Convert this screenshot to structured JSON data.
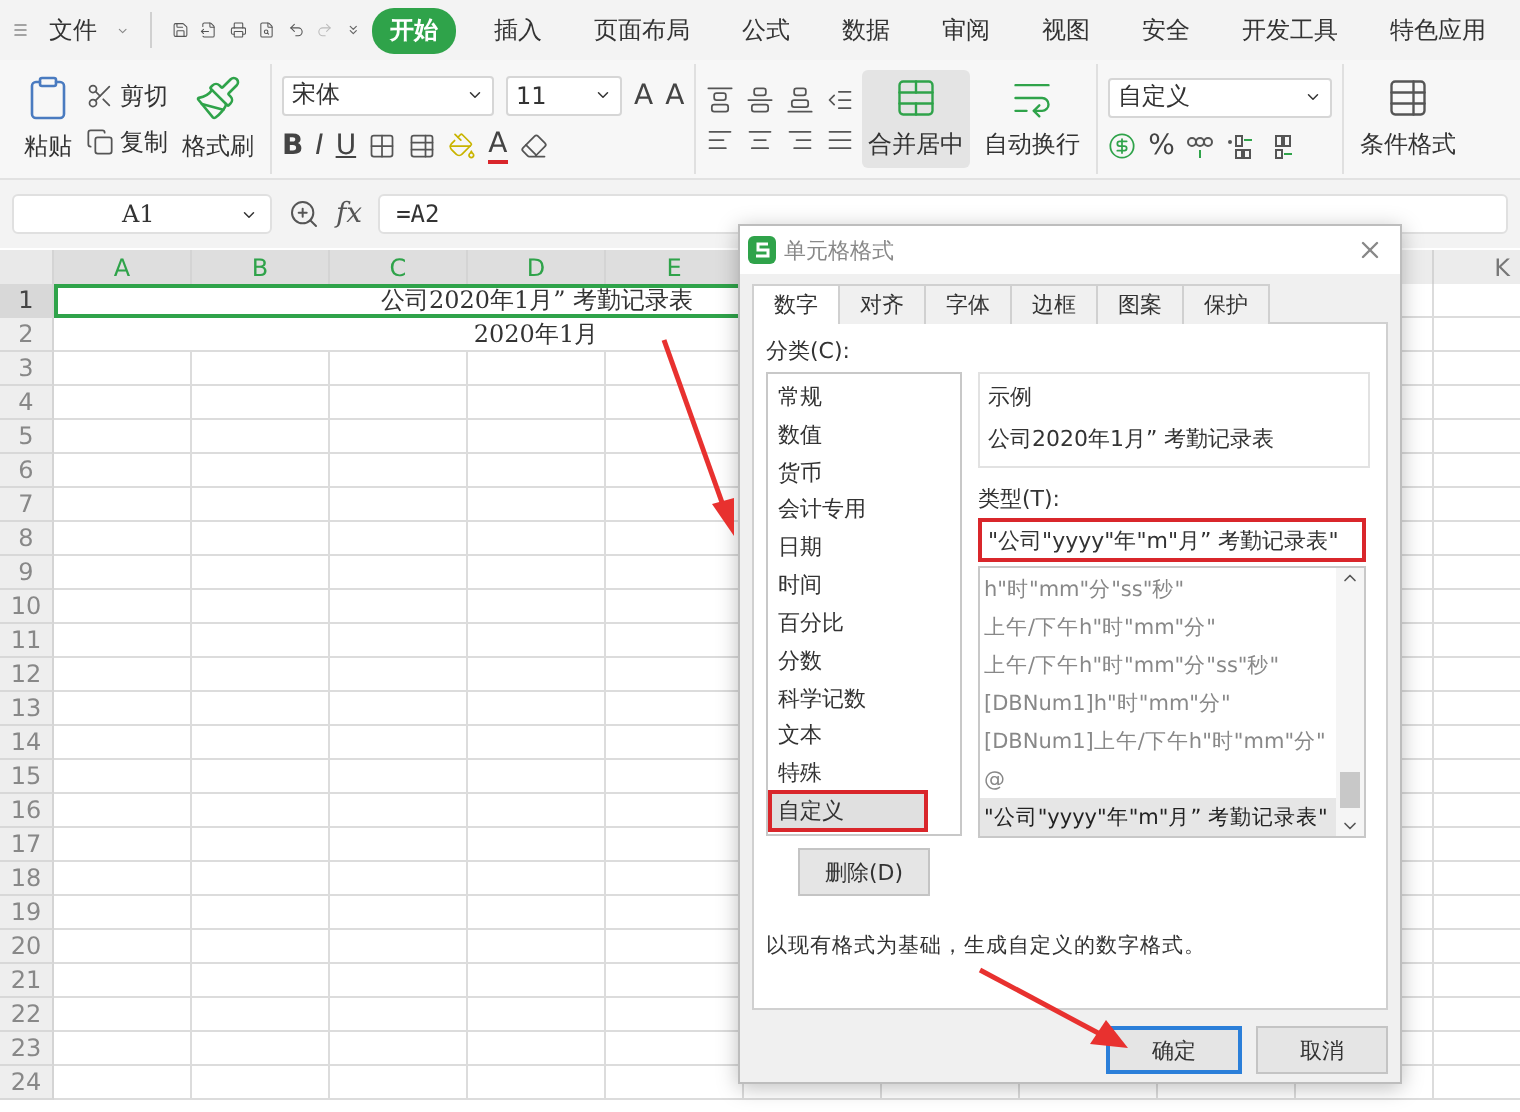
{
  "menu_bar": {
    "file_menu": "文件",
    "tabs": [
      {
        "label": "开始",
        "selected": true
      },
      {
        "label": "插入",
        "selected": false
      },
      {
        "label": "页面布局",
        "selected": false
      },
      {
        "label": "公式",
        "selected": false
      },
      {
        "label": "数据",
        "selected": false
      },
      {
        "label": "审阅",
        "selected": false
      },
      {
        "label": "视图",
        "selected": false
      },
      {
        "label": "安全",
        "selected": false
      },
      {
        "label": "开发工具",
        "selected": false
      },
      {
        "label": "特色应用",
        "selected": false
      }
    ]
  },
  "ribbon": {
    "paste": "粘贴",
    "cut": "剪切",
    "copy": "复制",
    "format_painter": "格式刷",
    "font_name": "宋体",
    "font_size": "11",
    "grow_font": "A",
    "shrink_font": "A",
    "bold": "B",
    "italic": "I",
    "underline": "U",
    "font_color": "A",
    "merge_center": "合并居中",
    "wrap_text": "自动换行",
    "number_format": "自定义",
    "percent": "%",
    "conditional_format": "条件格式"
  },
  "formula_bar": {
    "name_box": "A1",
    "fx": "fx",
    "formula": "=A2"
  },
  "sheet": {
    "columns": [
      {
        "label": "A",
        "selected": true
      },
      {
        "label": "B",
        "selected": true
      },
      {
        "label": "C",
        "selected": true
      },
      {
        "label": "D",
        "selected": true
      },
      {
        "label": "E",
        "selected": true
      }
    ],
    "far_column": {
      "label": "K",
      "selected": false
    },
    "rows": [
      {
        "label": "1",
        "selected": true,
        "merged_text": "公司2020年1月” 考勤记录表"
      },
      {
        "label": "2",
        "selected": false,
        "merged_text": "2020年1月"
      },
      {
        "label": "3",
        "selected": false
      },
      {
        "label": "4",
        "selected": false
      },
      {
        "label": "5",
        "selected": false
      },
      {
        "label": "6",
        "selected": false
      },
      {
        "label": "7",
        "selected": false
      },
      {
        "label": "8",
        "selected": false
      },
      {
        "label": "9",
        "selected": false
      },
      {
        "label": "10",
        "selected": false
      },
      {
        "label": "11",
        "selected": false
      },
      {
        "label": "12",
        "selected": false
      },
      {
        "label": "13",
        "selected": false
      },
      {
        "label": "14",
        "selected": false
      },
      {
        "label": "15",
        "selected": false
      },
      {
        "label": "16",
        "selected": false
      },
      {
        "label": "17",
        "selected": false
      },
      {
        "label": "18",
        "selected": false
      },
      {
        "label": "19",
        "selected": false
      },
      {
        "label": "20",
        "selected": false
      },
      {
        "label": "21",
        "selected": false
      },
      {
        "label": "22",
        "selected": false
      },
      {
        "label": "23",
        "selected": false
      },
      {
        "label": "24",
        "selected": false
      }
    ]
  },
  "dialog": {
    "title": "单元格格式",
    "tabs": [
      {
        "label": "数字",
        "selected": true
      },
      {
        "label": "对齐",
        "selected": false
      },
      {
        "label": "字体",
        "selected": false
      },
      {
        "label": "边框",
        "selected": false
      },
      {
        "label": "图案",
        "selected": false
      },
      {
        "label": "保护",
        "selected": false
      }
    ],
    "category_label": "分类(C):",
    "categories": [
      {
        "label": "常规",
        "selected": false,
        "annotated": false
      },
      {
        "label": "数值",
        "selected": false,
        "annotated": false
      },
      {
        "label": "货币",
        "selected": false,
        "annotated": false
      },
      {
        "label": "会计专用",
        "selected": false,
        "annotated": false
      },
      {
        "label": "日期",
        "selected": false,
        "annotated": false
      },
      {
        "label": "时间",
        "selected": false,
        "annotated": false
      },
      {
        "label": "百分比",
        "selected": false,
        "annotated": false
      },
      {
        "label": "分数",
        "selected": false,
        "annotated": false
      },
      {
        "label": "科学记数",
        "selected": false,
        "annotated": false
      },
      {
        "label": "文本",
        "selected": false,
        "annotated": false
      },
      {
        "label": "特殊",
        "selected": false,
        "annotated": false
      },
      {
        "label": "自定义",
        "selected": true,
        "annotated": true
      }
    ],
    "sample_label": "示例",
    "sample": "公司2020年1月” 考勤记录表",
    "type_label": "类型(T):",
    "type_value": "\"公司\"yyyy\"年\"m\"月” 考勤记录表\"",
    "type_annotated": true,
    "type_list": [
      {
        "label": "h\"时\"mm\"分\"ss\"秒\"",
        "selected": false
      },
      {
        "label": "上午/下午h\"时\"mm\"分\"",
        "selected": false
      },
      {
        "label": "上午/下午h\"时\"mm\"分\"ss\"秒\"",
        "selected": false
      },
      {
        "label": "[DBNum1]h\"时\"mm\"分\"",
        "selected": false
      },
      {
        "label": "[DBNum1]上午/下午h\"时\"mm\"分\"",
        "selected": false
      },
      {
        "label": "@",
        "selected": false
      },
      {
        "label": "\"公司\"yyyy\"年\"m\"月” 考勤记录表\"",
        "selected": true
      }
    ],
    "delete_button": "删除(D)",
    "description": "以现有格式为基础，生成自定义的数字格式。",
    "ok_button": "确定",
    "cancel_button": "取消"
  }
}
